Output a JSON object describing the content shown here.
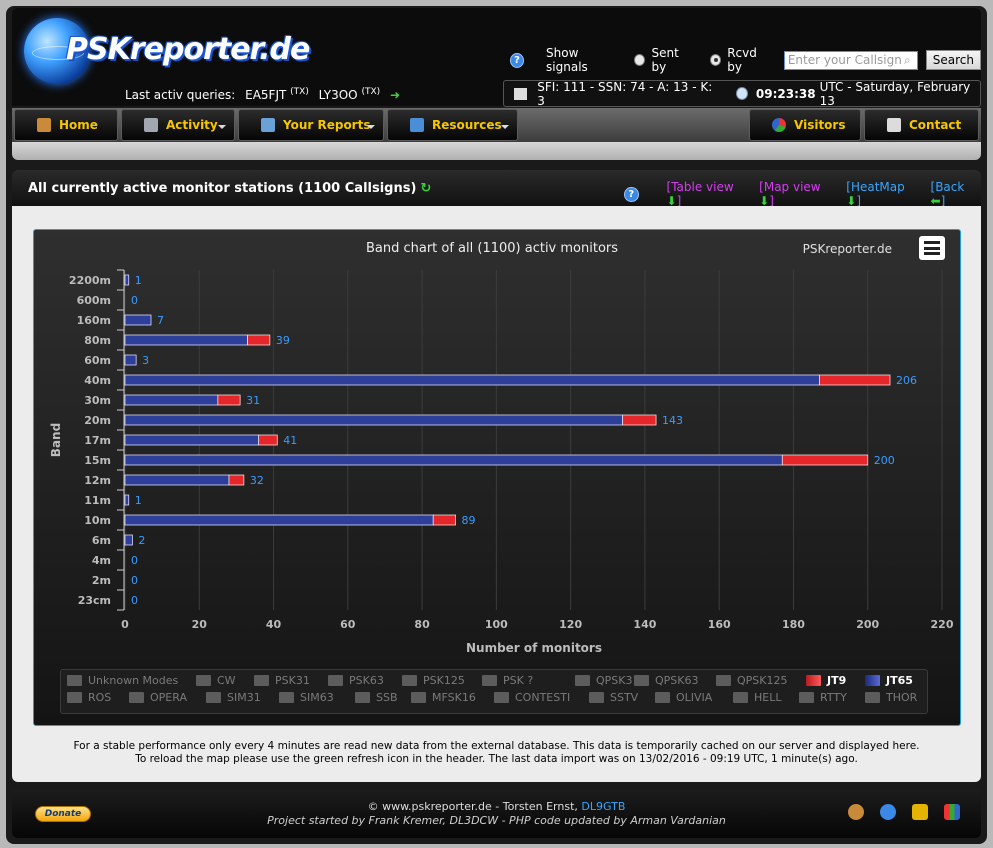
{
  "header": {
    "brand": "PSKreporter.de",
    "last_queries_label": "Last activ queries:",
    "queries": [
      {
        "call": "EA5FJT",
        "tag": "(TX)"
      },
      {
        "call": "LY3OO",
        "tag": "(TX)"
      }
    ],
    "help_glyph": "?",
    "show_signals_label": "Show signals",
    "sent_by_label": "Sent by",
    "rcvd_by_label": "Rcvd by",
    "sent_by_selected": false,
    "rcvd_by_selected": true,
    "callsign_placeholder": "Enter your Callsign",
    "search_label": "Search",
    "solar": "SFI: 111 - SSN: 74 - A: 13 - K: 3",
    "time": "09:23:38",
    "date_suffix": "UTC - Saturday, February 13"
  },
  "nav": {
    "items": [
      "Home",
      "Activity",
      "Your Reports",
      "Resources",
      "Visitors",
      "Contact"
    ]
  },
  "page": {
    "title": "All currently active monitor stations (1100 Callsigns)",
    "refresh_glyph": "↻",
    "views": {
      "table": "[Table view",
      "map": "[Map view",
      "heatmap": "[HeatMap",
      "back": "[Back",
      "close": "]"
    },
    "arrow_down": "⬇",
    "arrow_left": "⬅"
  },
  "chart_data": {
    "type": "bar",
    "orientation": "horizontal",
    "stacked": true,
    "title": "Band chart of all (1100) activ monitors",
    "credit": "PSKreporter.de",
    "xlabel": "Number of monitors",
    "ylabel": "Band",
    "xlim": [
      0,
      220
    ],
    "xticks": [
      0,
      20,
      40,
      60,
      80,
      100,
      120,
      140,
      160,
      180,
      200,
      220
    ],
    "grid": true,
    "legend_position": "bottom",
    "categories": [
      "2200m",
      "600m",
      "160m",
      "80m",
      "60m",
      "40m",
      "30m",
      "20m",
      "17m",
      "15m",
      "12m",
      "11m",
      "10m",
      "6m",
      "4m",
      "2m",
      "23cm"
    ],
    "totals": [
      1,
      0,
      7,
      39,
      3,
      206,
      31,
      143,
      41,
      200,
      32,
      1,
      89,
      2,
      0,
      0,
      0
    ],
    "series": [
      {
        "name": "JT65",
        "color": "#2e3f9a",
        "values": [
          1,
          0,
          7,
          33,
          3,
          187,
          25,
          134,
          36,
          177,
          28,
          1,
          83,
          2,
          0,
          0,
          0
        ]
      },
      {
        "name": "JT9",
        "color": "#e5262b",
        "values": [
          0,
          0,
          0,
          6,
          0,
          19,
          6,
          9,
          5,
          23,
          4,
          0,
          6,
          0,
          0,
          0,
          0
        ]
      }
    ],
    "legend_items": [
      {
        "name": "Unknown Modes",
        "active": false
      },
      {
        "name": "CW",
        "active": false
      },
      {
        "name": "PSK31",
        "active": false
      },
      {
        "name": "PSK63",
        "active": false
      },
      {
        "name": "PSK125",
        "active": false
      },
      {
        "name": "PSK ?",
        "active": false
      },
      {
        "name": "QPSK31",
        "active": false
      },
      {
        "name": "QPSK63",
        "active": false
      },
      {
        "name": "QPSK125",
        "active": false
      },
      {
        "name": "JT9",
        "active": true
      },
      {
        "name": "JT65",
        "active": true
      },
      {
        "name": "ROS",
        "active": false
      },
      {
        "name": "OPERA",
        "active": false
      },
      {
        "name": "SIM31",
        "active": false
      },
      {
        "name": "SIM63",
        "active": false
      },
      {
        "name": "SSB",
        "active": false
      },
      {
        "name": "MFSK16",
        "active": false
      },
      {
        "name": "CONTESTI",
        "active": false
      },
      {
        "name": "SSTV",
        "active": false
      },
      {
        "name": "OLIVIA",
        "active": false
      },
      {
        "name": "HELL",
        "active": false
      },
      {
        "name": "RTTY",
        "active": false
      },
      {
        "name": "THOR",
        "active": false
      }
    ]
  },
  "note": {
    "line1": "For a stable performance only every 4 minutes are read new data from the external database. This data is temporarily cached on our server and displayed here.",
    "line2": "To reload the map please use the green refresh icon in the header. The last data import was on 13/02/2016 - 09:19 UTC, 1 minute(s) ago."
  },
  "footer": {
    "donate": "Donate",
    "copyright": "© www.pskreporter.de - Torsten Ernst,",
    "author_call": "DL9GTB",
    "credits": "Project started by Frank Kremer, DL3DCW - PHP code updated by Arman Vardanian"
  },
  "colors": {
    "accent_yellow": "#f6c700",
    "link_blue": "#35a6ff",
    "view_magenta": "#d53cf0",
    "jt65": "#2e3f9a",
    "jt9": "#e5262b"
  }
}
